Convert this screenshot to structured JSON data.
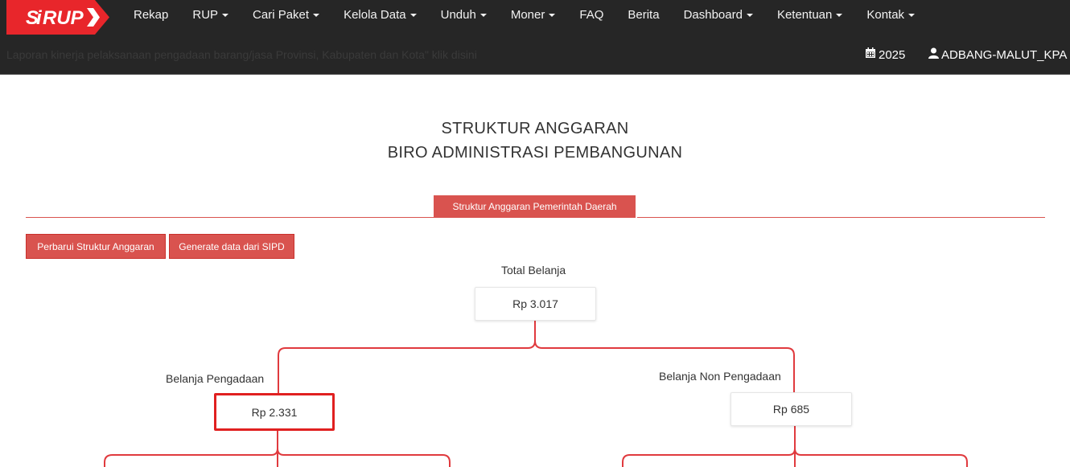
{
  "brand": {
    "logo_text": "SiRUP",
    "accent": "#e8262b"
  },
  "nav": {
    "items": [
      {
        "label": "Rekap",
        "dropdown": false
      },
      {
        "label": "RUP",
        "dropdown": true
      },
      {
        "label": "Cari Paket",
        "dropdown": true
      },
      {
        "label": "Kelola Data",
        "dropdown": true
      },
      {
        "label": "Unduh",
        "dropdown": true
      },
      {
        "label": "Moner",
        "dropdown": true
      },
      {
        "label": "FAQ",
        "dropdown": false
      },
      {
        "label": "Berita",
        "dropdown": false
      },
      {
        "label": "Dashboard",
        "dropdown": true
      },
      {
        "label": "Ketentuan",
        "dropdown": true
      },
      {
        "label": "Kontak",
        "dropdown": true
      }
    ],
    "ticker": "Laporan kinerja pelaksanaan pengadaan barang/jasa Provinsi, Kabupaten dan Kota\" klik disini",
    "year": "2025",
    "user": "ADBANG-MALUT_KPA",
    "icons": {
      "year": "calendar-icon",
      "user": "user-icon"
    }
  },
  "page": {
    "title_line1": "STRUKTUR ANGGARAN",
    "title_line2": "BIRO ADMINISTRASI PEMBANGUNAN"
  },
  "tabs": {
    "active": "Struktur Anggaran Pemerintah Daerah"
  },
  "actions": {
    "update_label": "Perbarui Struktur Anggaran",
    "generate_label": "Generate data dari SIPD"
  },
  "tree": {
    "root": {
      "label": "Total Belanja",
      "value": "Rp 3.017"
    },
    "left": {
      "label": "Belanja Pengadaan",
      "value": "Rp 2.331",
      "selected": true
    },
    "right": {
      "label": "Belanja Non Pengadaan",
      "value": "Rp 685"
    }
  },
  "colors": {
    "nav_bg": "#262626",
    "danger": "#d9534f",
    "connector": "#e03a3e",
    "selected_border": "#e02020"
  }
}
